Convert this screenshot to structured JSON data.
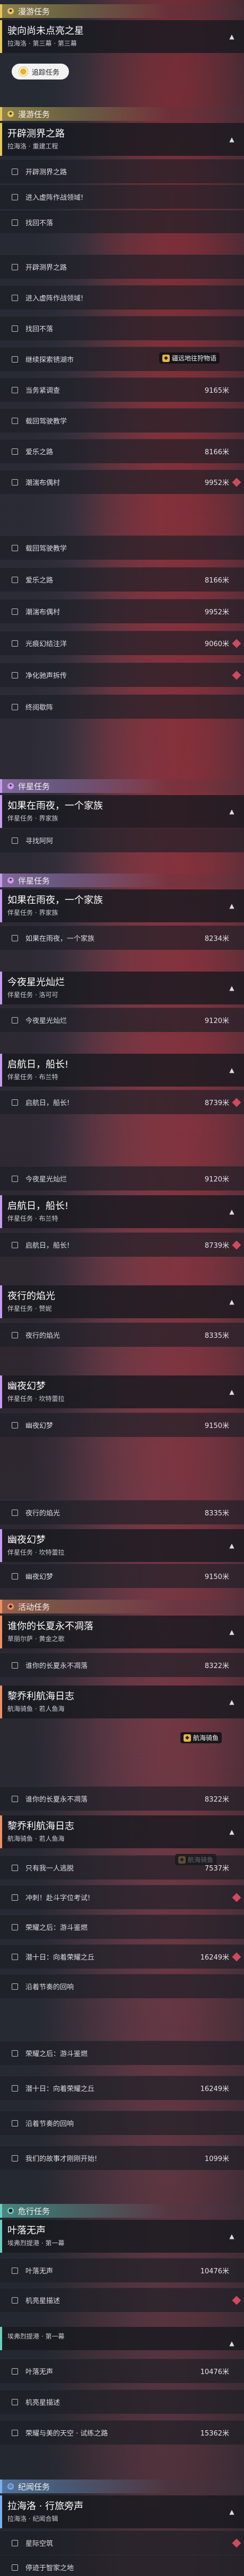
{
  "colors": {
    "companion": "#c89bf0",
    "main": "#e6c85a",
    "event": "#f09060",
    "daily": "#6ad0c0",
    "season": "#7ab0f0",
    "pin": "#d04a5c"
  },
  "card1": {
    "section": "漫游任务",
    "title": "驶向尚未点亮之星",
    "subtitle": "拉海洛 · 第三幕 · 第三幕",
    "button": "追踪任务"
  },
  "card2": {
    "section": "漫游任务",
    "title": "开辟测界之路",
    "subtitle": "拉海洛 · 重建工程",
    "rows": [
      "开辟测界之路",
      "进入虚阵作战领域!",
      "找回不落"
    ]
  },
  "card3": {
    "rows": [
      {
        "label": "开辟测界之路",
        "dist": ""
      },
      {
        "label": "进入虚阵作战领域!",
        "dist": ""
      },
      {
        "label": "找回不落",
        "dist": ""
      },
      {
        "label": "继续探索锈湖市",
        "dist": ""
      },
      {
        "label": "当务紧调查",
        "dist": "9165米"
      },
      {
        "label": "载回驾驶教学",
        "dist": ""
      },
      {
        "label": "爱乐之路",
        "dist": "8166米"
      },
      {
        "label": "潮湍布偶村",
        "dist": "9952米"
      }
    ],
    "badge": "疆远地往狩物语"
  },
  "card4": {
    "rows": [
      {
        "label": "载回驾驶教学",
        "dist": ""
      },
      {
        "label": "爱乐之路",
        "dist": "8166米"
      },
      {
        "label": "潮湍布偶村",
        "dist": "9952米"
      },
      {
        "label": "光痕幻结注洋",
        "dist": "9060米"
      },
      {
        "label": "净化驰声拆传",
        "dist": ""
      },
      {
        "label": "终阅歇阵",
        "dist": ""
      }
    ]
  },
  "card5": {
    "section": "伴星任务",
    "title": "如果在雨夜，一个家族",
    "subtitle": "伴星任务 · 界家族",
    "rows": [
      "寻找阿阿"
    ]
  },
  "card6": {
    "section": "伴星任务",
    "quests": [
      {
        "title": "如果在雨夜，一个家族",
        "subtitle": "伴星任务 · 界家族",
        "row": "如果在雨夜，一个家族",
        "dist": "8234米"
      },
      {
        "title": "今夜星光灿烂",
        "subtitle": "伴星任务 · 洛可可",
        "row": "今夜星光灿烂",
        "dist": "9120米"
      },
      {
        "title": "启航日，船长!",
        "subtitle": "伴星任务 · 布兰特",
        "row": "启航日，船长!",
        "dist": "8739米"
      }
    ]
  },
  "card7": {
    "quests": [
      {
        "title": "",
        "subtitle": "",
        "row": "今夜星光灿烂",
        "dist": "9120米"
      },
      {
        "title": "启航日，船长!",
        "subtitle": "伴星任务 · 布兰特",
        "row": "启航日，船长!",
        "dist": "8739米"
      },
      {
        "title": "夜行的焰光",
        "subtitle": "伴星任务 · 赞妮",
        "row": "夜行的焰光",
        "dist": "8335米"
      },
      {
        "title": "幽夜幻梦",
        "subtitle": "伴星任务 · 坎特蕾拉",
        "row": "幽夜幻梦",
        "dist": "9150米"
      }
    ]
  },
  "card8": {
    "quests": [
      {
        "title": "",
        "subtitle": "",
        "row": "夜行的焰光",
        "dist": "8335米"
      },
      {
        "title": "幽夜幻梦",
        "subtitle": "伴星任务 · 坎特蕾拉",
        "row": "幽夜幻梦",
        "dist": "9150米"
      }
    ]
  },
  "card9": {
    "section": "活动任务",
    "quests": [
      {
        "title": "谁你的长夏永不凋落",
        "subtitle": "草丽尔萨 · 黄金之歌",
        "row": "谁你的长夏永不凋落",
        "dist": "8322米"
      },
      {
        "title": "黎乔利航海日志",
        "subtitle": "航海骑鱼 · 若人鱼海",
        "row": "",
        "dist": ""
      }
    ],
    "badge": "航海骑鱼"
  },
  "card10": {
    "row0": {
      "label": "谁你的长夏永不凋落",
      "dist": "8322米"
    },
    "title": "黎乔利航海日志",
    "subtitle": "航海骑鱼 · 若人鱼海",
    "badge": "航海骑鱼",
    "rows": [
      {
        "label": "只有我一人逃脱",
        "dist": "7537米"
      },
      {
        "label": "冲刺！赴斗字位考试!",
        "dist": ""
      },
      {
        "label": "荣耀之后：游斗鉴燃",
        "dist": ""
      },
      {
        "label": "潜十日：向着荣耀之丘",
        "dist": "16249米"
      },
      {
        "label": "沿着节奏的回响",
        "dist": ""
      }
    ]
  },
  "card11": {
    "rows": [
      {
        "label": "荣耀之后：游斗鉴燃",
        "dist": ""
      },
      {
        "label": "潜十日：向着荣耀之丘",
        "dist": "16249米"
      },
      {
        "label": "沿着节奏的回响",
        "dist": ""
      },
      {
        "label": "我们的故事才刚刚开始!",
        "dist": "1099米"
      }
    ]
  },
  "card12": {
    "section": "危行任务",
    "title": "叶落无声",
    "subtitle": "埃弗烈提港 · 第一幕",
    "rows": [
      {
        "label": "叶落无声",
        "dist": "10476米"
      },
      {
        "label": "机亮星描述",
        "dist": ""
      }
    ]
  },
  "card13": {
    "title": "",
    "subtitle": "埃弗烈提港 · 第一幕",
    "rows": [
      {
        "label": "叶落无声",
        "dist": "10476米"
      },
      {
        "label": "机亮星描述",
        "dist": ""
      },
      {
        "label": "荣耀与美的天空 · 试练之路",
        "dist": "15362米"
      }
    ]
  },
  "card14": {
    "section": "纪闻任务",
    "title": "拉海洛 · 行旅旁声",
    "subtitle": "拉海洛 · 纪闻合辑",
    "rows": [
      {
        "label": "星际空筑",
        "dist": ""
      },
      {
        "label": "停迹于智家之地",
        "dist": ""
      }
    ]
  }
}
